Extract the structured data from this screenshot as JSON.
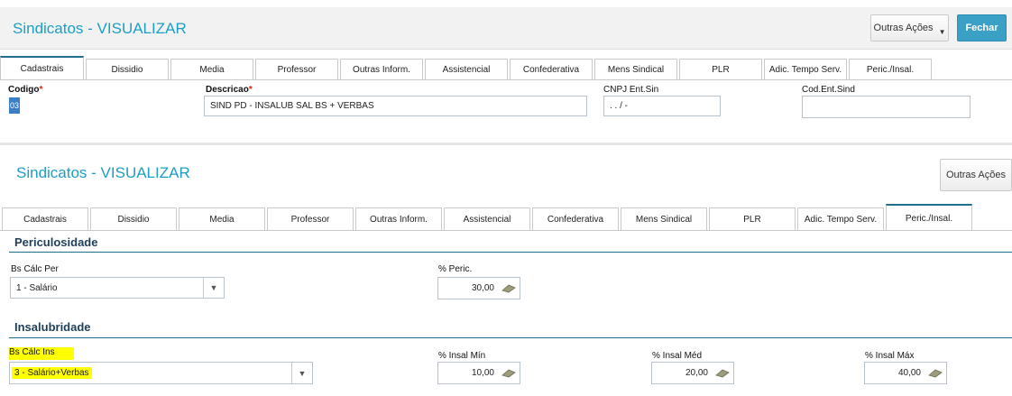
{
  "top": {
    "title": "Sindicatos - VISUALIZAR",
    "other_actions": "Outras Ações",
    "close": "Fechar",
    "tabs": [
      "Cadastrais",
      "Dissidio",
      "Media",
      "Professor",
      "Outras Inform.",
      "Assistencial",
      "Confederativa",
      "Mens Sindical",
      "PLR",
      "Adic. Tempo Serv.",
      "Peric./Insal."
    ],
    "active_tab": "Cadastrais",
    "fields": {
      "codigo_label": "Codigo",
      "codigo_value": "03",
      "descricao_label": "Descricao",
      "descricao_value": "SIND PD - INSALUB SAL BS + VERBAS",
      "cnpj_label": "CNPJ Ent.Sin",
      "cnpj_value": ". . / -",
      "cod_ent_label": "Cod.Ent.Sind",
      "cod_ent_value": ""
    }
  },
  "bottom": {
    "title": "Sindicatos - VISUALIZAR",
    "other_actions": "Outras Ações",
    "tabs": [
      "Cadastrais",
      "Dissidio",
      "Media",
      "Professor",
      "Outras Inform.",
      "Assistencial",
      "Confederativa",
      "Mens Sindical",
      "PLR",
      "Adic. Tempo Serv.",
      "Peric./Insal."
    ],
    "active_tab": "Peric./Insal.",
    "periculosidade": {
      "section": "Periculosidade",
      "bs_label": "Bs Cálc Per",
      "bs_value": "1 - Salário",
      "pct_label": "% Peric.",
      "pct_value": "30,00"
    },
    "insalubridade": {
      "section": "Insalubridade",
      "bs_label": "Bs Cálc Ins",
      "bs_value": "3 - Salário+Verbas",
      "min_label": "% Insal Mín",
      "min_value": "10,00",
      "med_label": "% Insal Méd",
      "med_value": "20,00",
      "max_label": "% Insal Máx",
      "max_value": "40,00"
    }
  },
  "colors": {
    "accent": "#1d9ec4",
    "primary_button": "#3aa0c6",
    "section_line": "#1d6e8f",
    "highlight": "#ffff00"
  },
  "icons": {
    "calc": "calculator-icon",
    "dropdown": "chevron-down-icon"
  }
}
